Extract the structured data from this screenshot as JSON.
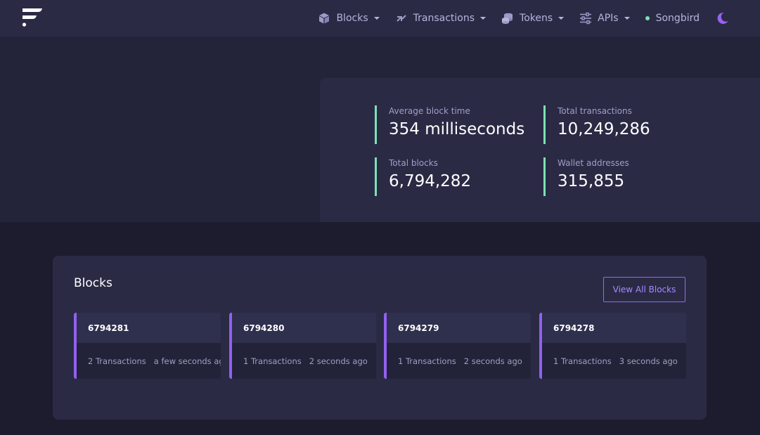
{
  "nav": {
    "items": [
      {
        "label": "Blocks",
        "icon": "cube-icon"
      },
      {
        "label": "Transactions",
        "icon": "swap-arrows-icon"
      },
      {
        "label": "Tokens",
        "icon": "coins-icon"
      },
      {
        "label": "APIs",
        "icon": "sliders-icon"
      }
    ],
    "network": {
      "label": "Songbird",
      "status_color": "#7ee0b2"
    },
    "theme_toggle_icon": "moon-icon"
  },
  "stats": {
    "avg_block_time": {
      "label": "Average block time",
      "value": "354 milliseconds"
    },
    "total_transactions": {
      "label": "Total transactions",
      "value": "10,249,286"
    },
    "total_blocks": {
      "label": "Total blocks",
      "value": "6,794,282"
    },
    "wallet_addresses": {
      "label": "Wallet addresses",
      "value": "315,855"
    }
  },
  "blocks_panel": {
    "title": "Blocks",
    "view_all_label": "View All Blocks",
    "blocks": [
      {
        "number": "6794281",
        "transactions": "2 Transactions",
        "age": "a few seconds ago"
      },
      {
        "number": "6794280",
        "transactions": "1 Transactions",
        "age": "2 seconds ago"
      },
      {
        "number": "6794279",
        "transactions": "1 Transactions",
        "age": "2 seconds ago"
      },
      {
        "number": "6794278",
        "transactions": "1 Transactions",
        "age": "3 seconds ago"
      }
    ]
  },
  "colors": {
    "accent_purple": "#9260f0",
    "accent_green": "#7ee0b2",
    "nav_bg": "#2a2a45",
    "page_bg": "#1c1c2e"
  }
}
